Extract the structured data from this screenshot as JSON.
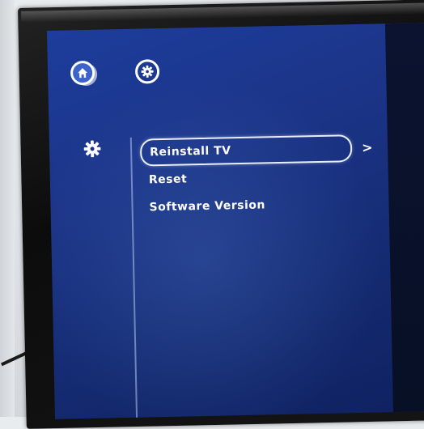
{
  "screen": {
    "top_buttons": [
      {
        "icon": "home-icon",
        "selected": true
      },
      {
        "icon": "gear-icon",
        "selected": false
      }
    ],
    "section_icon": "gear-icon",
    "menu": {
      "items": [
        {
          "label": "Reinstall TV",
          "selected": true,
          "has_submenu": true
        },
        {
          "label": "Reset",
          "selected": false,
          "has_submenu": false
        },
        {
          "label": "Software Version",
          "selected": false,
          "has_submenu": false
        }
      ],
      "submenu_arrow": ">"
    }
  },
  "colors": {
    "screen_bg": "#1b3487",
    "highlight_fill": "#3b63c9",
    "text": "#ffffff"
  }
}
